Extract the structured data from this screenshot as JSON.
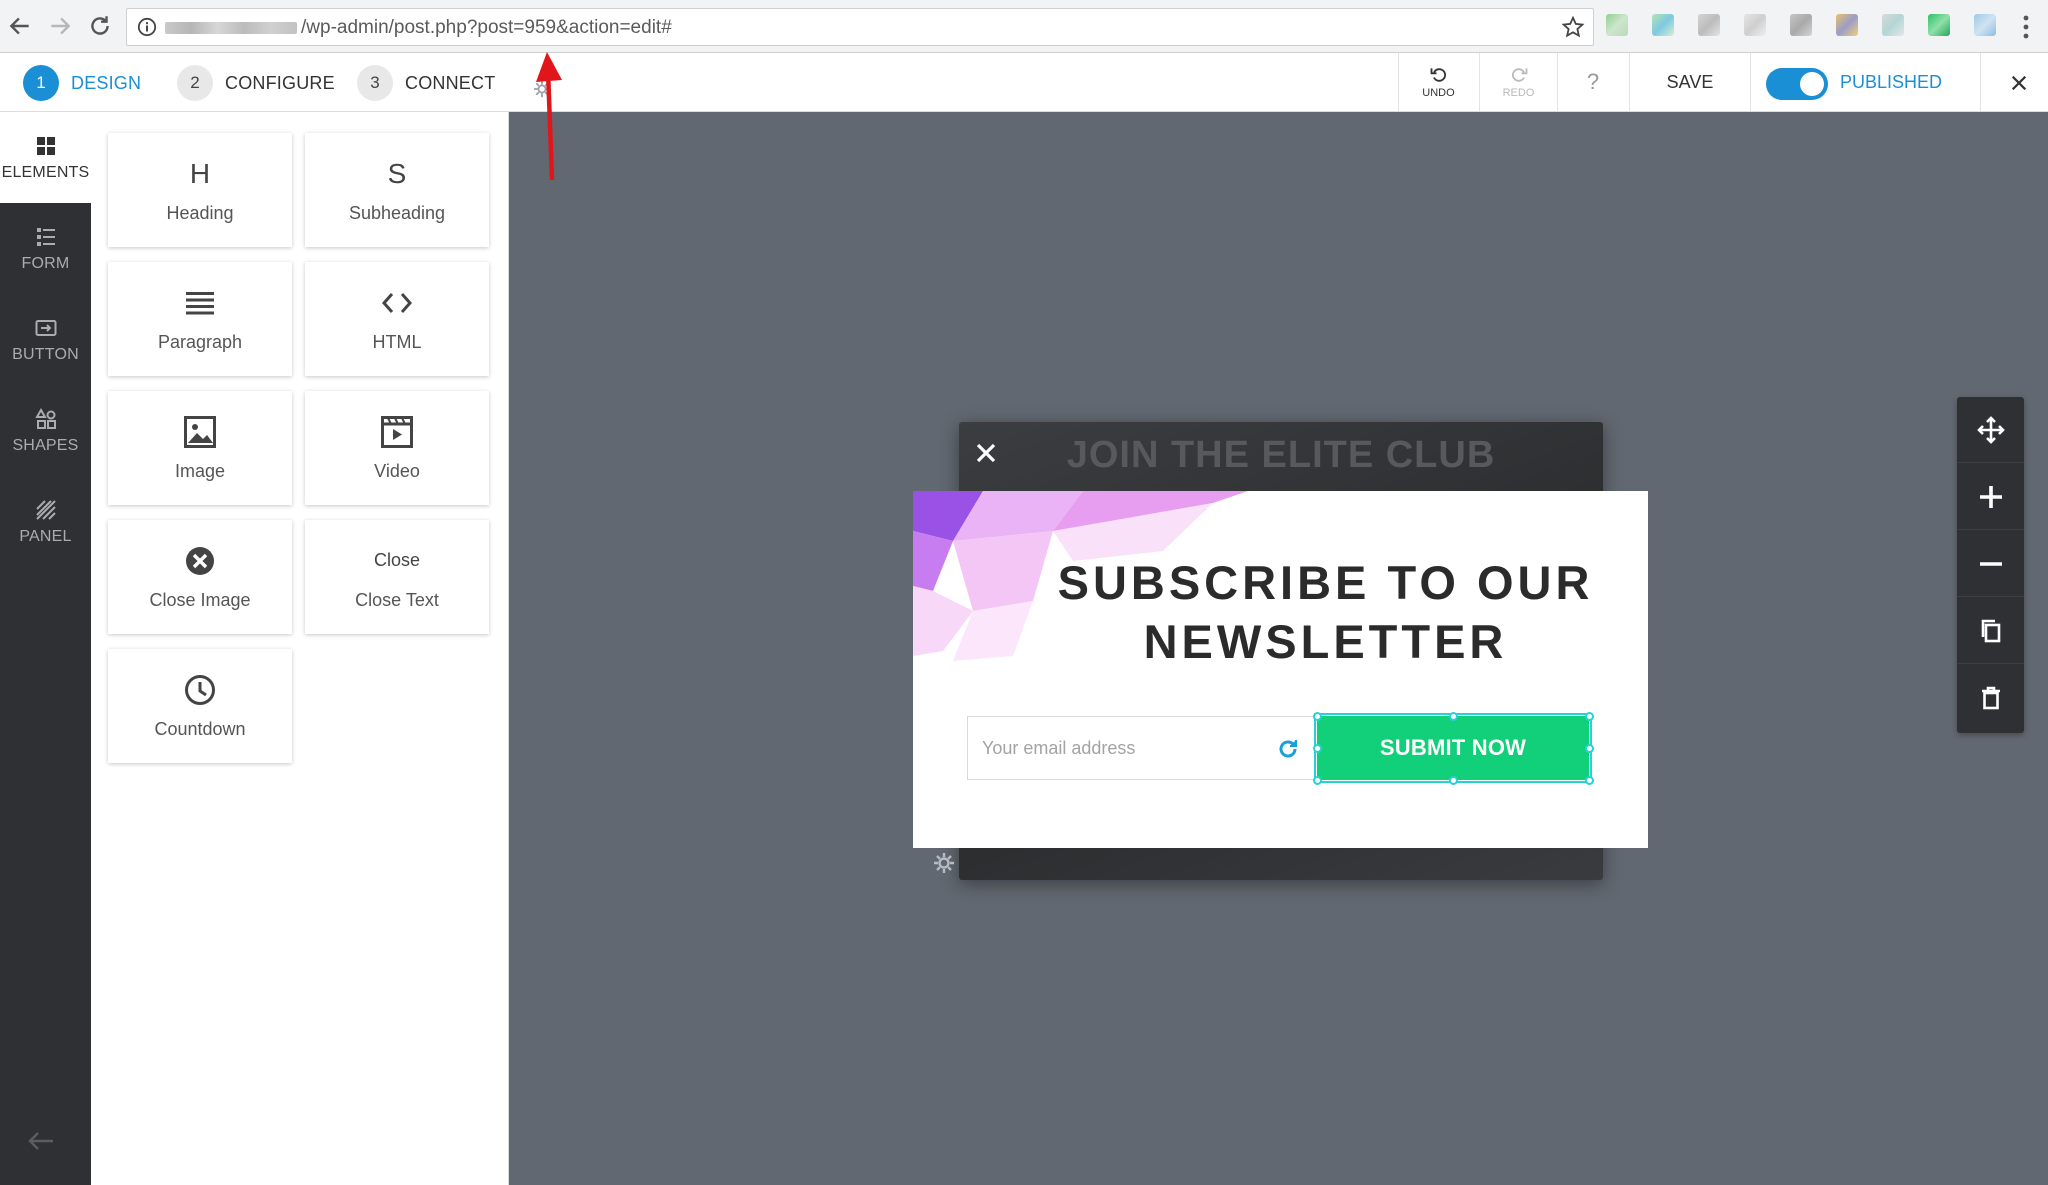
{
  "browser": {
    "url_path": "/wp-admin/post.php?post=959&action=edit#"
  },
  "editor": {
    "steps": [
      {
        "num": "1",
        "label": "DESIGN"
      },
      {
        "num": "2",
        "label": "CONFIGURE"
      },
      {
        "num": "3",
        "label": "CONNECT"
      }
    ],
    "undo_label": "UNDO",
    "redo_label": "REDO",
    "help_label": "?",
    "save_label": "SAVE",
    "published_label": "PUBLISHED",
    "published_on": true
  },
  "sidebar": {
    "items": [
      {
        "label": "ELEMENTS",
        "icon": "grid-icon"
      },
      {
        "label": "FORM",
        "icon": "form-icon"
      },
      {
        "label": "BUTTON",
        "icon": "button-icon"
      },
      {
        "label": "SHAPES",
        "icon": "shapes-icon"
      },
      {
        "label": "PANEL",
        "icon": "panel-icon"
      }
    ]
  },
  "elements": {
    "heading": {
      "icon_text": "H",
      "label": "Heading"
    },
    "subheading": {
      "icon_text": "S",
      "label": "Subheading"
    },
    "paragraph": {
      "label": "Paragraph"
    },
    "html": {
      "label": "HTML"
    },
    "image": {
      "label": "Image"
    },
    "video": {
      "label": "Video"
    },
    "close_image": {
      "label": "Close Image"
    },
    "close_text": {
      "icon_text": "Close",
      "label": "Close Text"
    },
    "countdown": {
      "label": "Countdown"
    }
  },
  "canvas": {
    "background_popup_heading": "JOIN THE ELITE CLUB",
    "popup": {
      "title_line1": "SUBSCRIBE TO OUR",
      "title_line2": "NEWSLETTER",
      "email_placeholder": "Your email address",
      "submit_label": "SUBMIT NOW"
    }
  },
  "colors": {
    "accent_blue": "#1a8fd6",
    "submit_green": "#12cf7a",
    "canvas_bg": "#626871",
    "sidebar_dark": "#2e3033",
    "annotation_red": "#e0161b"
  }
}
